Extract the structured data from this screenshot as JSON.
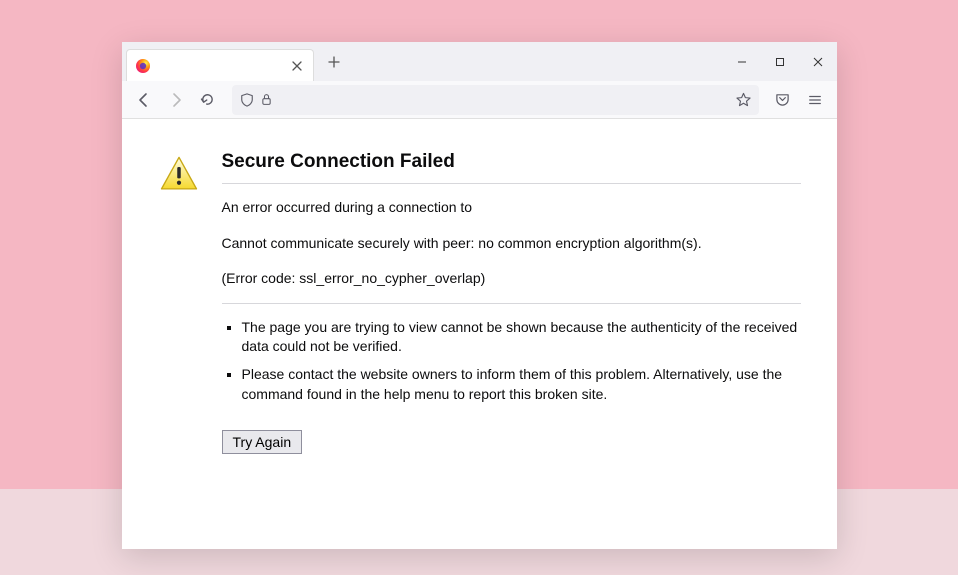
{
  "tab": {
    "title": ""
  },
  "content": {
    "title": "Secure Connection Failed",
    "para1": "An error occurred during a connection to",
    "para2": "Cannot communicate securely with peer: no common encryption algorithm(s).",
    "para3": "(Error code: ssl_error_no_cypher_overlap)",
    "bullets": [
      "The page you are trying to view cannot be shown because the authenticity of the received data could not be verified.",
      "Please contact the website owners to inform them of this problem. Alternatively, use the command found in the help menu to report this broken site."
    ],
    "button": "Try Again"
  }
}
